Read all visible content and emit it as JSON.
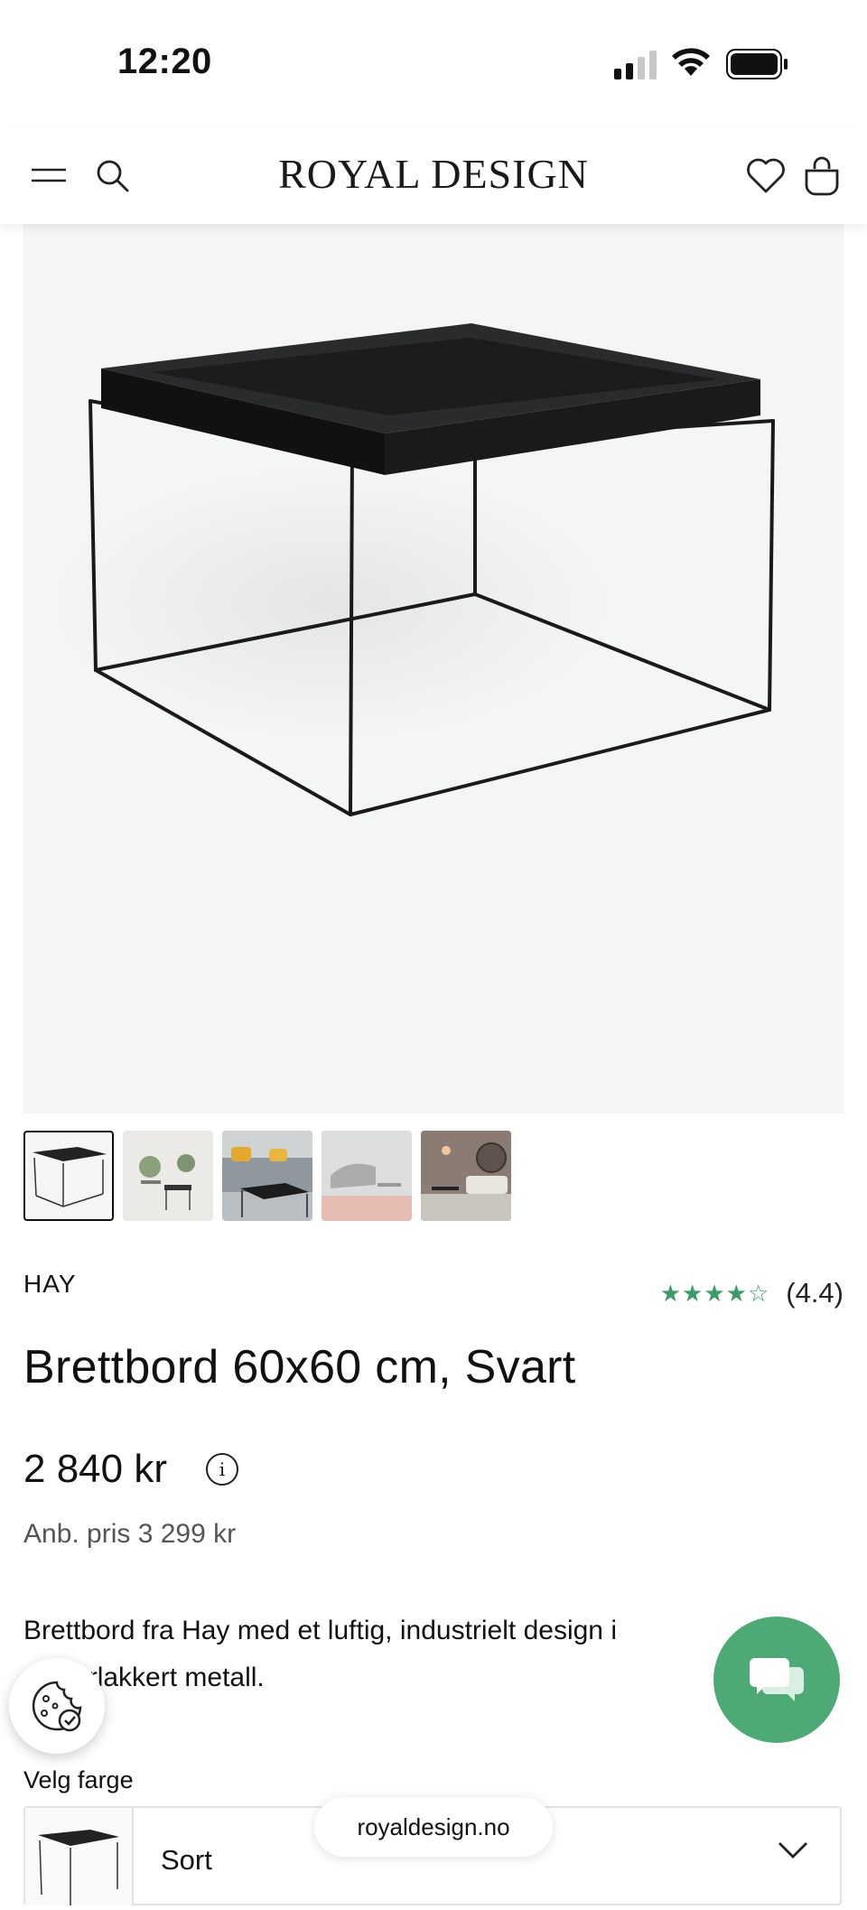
{
  "status_bar": {
    "time": "12:20"
  },
  "header": {
    "logo": "ROYAL DESIGN",
    "menu_icon": "menu-icon",
    "search_icon": "search-icon",
    "wishlist_icon": "heart-icon",
    "cart_icon": "bag-icon"
  },
  "product": {
    "brand": "HAY",
    "rating_stars": "★★★★☆",
    "rating_value": "(4.4)",
    "title": "Brettbord 60x60 cm, Svart",
    "price": "2 840 kr",
    "original_price": "Anb. pris 3 299 kr",
    "description": "Brettbord fra Hay med et luftig, industrielt design i pulverlakkert metall.",
    "thumbnails": 5,
    "active_thumbnail": 1
  },
  "color_select": {
    "label": "Velg farge",
    "value": "Sort"
  },
  "browser": {
    "url": "royaldesign.no"
  },
  "colors": {
    "accent_green": "#4daa77",
    "star_green": "#3a9c6a"
  }
}
